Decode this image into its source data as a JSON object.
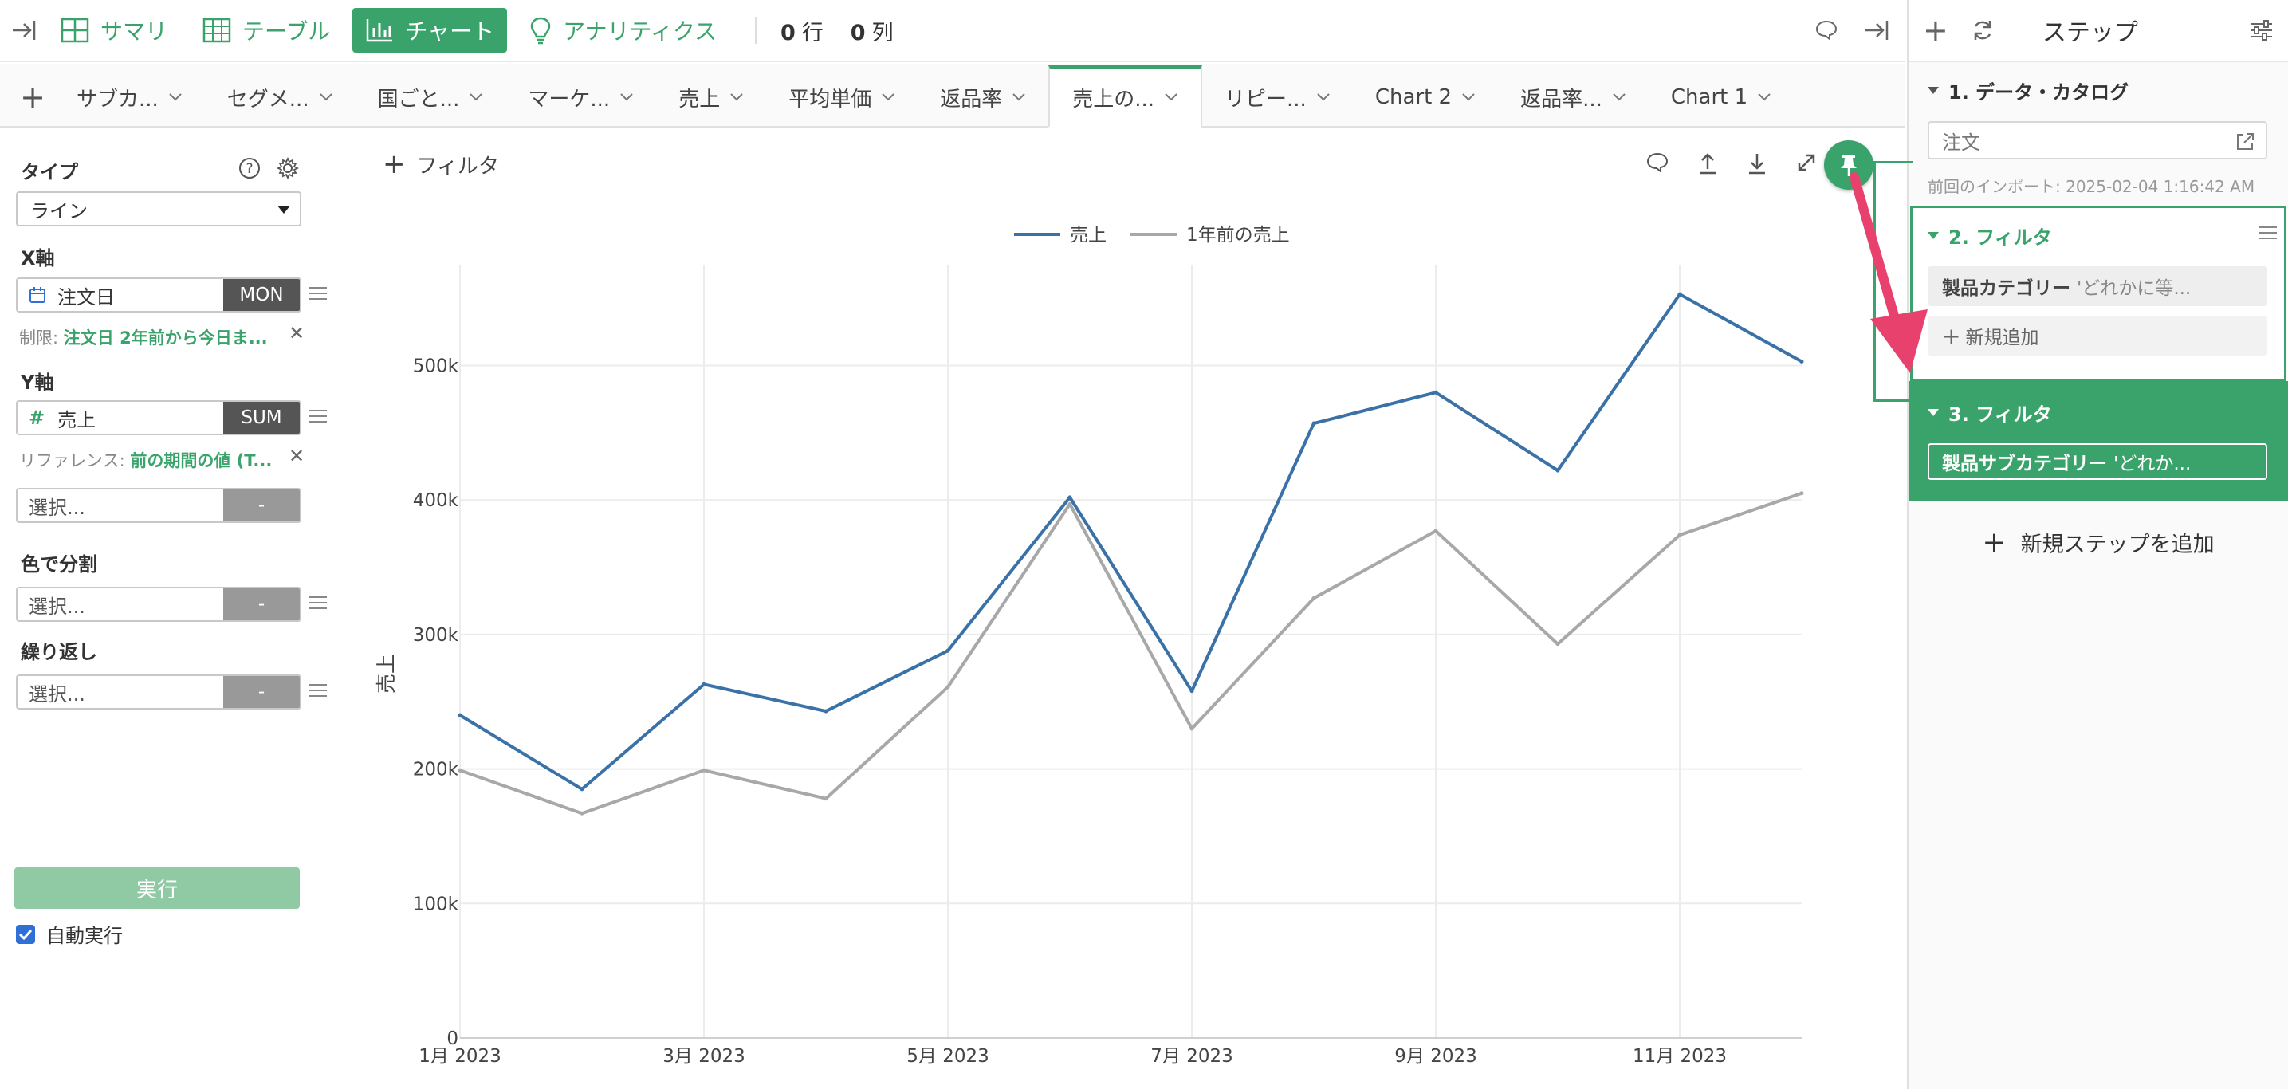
{
  "toolbar": {
    "summary": "サマリ",
    "table": "テーブル",
    "chart": "チャート",
    "analytics": "アナリティクス",
    "rows_num": "0",
    "rows_unit": "行",
    "cols_num": "0",
    "cols_unit": "列"
  },
  "tabs": [
    {
      "label": "サブカ..."
    },
    {
      "label": "セグメ..."
    },
    {
      "label": "国ごと..."
    },
    {
      "label": "マーケ..."
    },
    {
      "label": "売上"
    },
    {
      "label": "平均単価"
    },
    {
      "label": "返品率"
    },
    {
      "label": "売上の...",
      "active": true
    },
    {
      "label": "リピー..."
    },
    {
      "label": "Chart 2"
    },
    {
      "label": "返品率..."
    },
    {
      "label": "Chart 1"
    }
  ],
  "config": {
    "type_label": "タイプ",
    "type_value": "ライン",
    "x_label": "X軸",
    "x_field": "注文日",
    "x_agg": "MON",
    "x_limit_prefix": "制限: ",
    "x_limit_value": "注文日 2年前から今日ま...",
    "y_label": "Y軸",
    "y_field": "売上",
    "y_agg": "SUM",
    "y_ref_prefix": "リファレンス: ",
    "y_ref_value": "前の期間の値 (T...",
    "extra_placeholder": "選択...",
    "extra_agg": "-",
    "color_label": "色で分割",
    "color_placeholder": "選択...",
    "color_agg": "-",
    "repeat_label": "繰り返し",
    "repeat_placeholder": "選択...",
    "repeat_agg": "-",
    "run_label": "実行",
    "auto_run_label": "自動実行"
  },
  "chart_header": {
    "filter_add": "フィルタ"
  },
  "chart_data": {
    "type": "line",
    "title": "",
    "xlabel": "",
    "ylabel": "売上",
    "x": [
      "2023-01",
      "2023-02",
      "2023-03",
      "2023-04",
      "2023-05",
      "2023-06",
      "2023-07",
      "2023-08",
      "2023-09",
      "2023-10",
      "2023-11",
      "2023-12"
    ],
    "x_tick_labels": [
      "1月 2023",
      "3月 2023",
      "5月 2023",
      "7月 2023",
      "9月 2023",
      "11月 2023"
    ],
    "x_tick_indices": [
      0,
      2,
      4,
      6,
      8,
      10
    ],
    "y_ticks": [
      0,
      100000,
      200000,
      300000,
      400000,
      500000
    ],
    "y_tick_labels": [
      "0",
      "100k",
      "200k",
      "300k",
      "400k",
      "500k"
    ],
    "ylim": [
      0,
      575000
    ],
    "grid": true,
    "legend_position": "top",
    "series": [
      {
        "name": "売上",
        "color": "#3a72a8",
        "values": [
          240000,
          185000,
          263000,
          243000,
          288000,
          402000,
          258000,
          457000,
          480000,
          422000,
          553000,
          503000
        ]
      },
      {
        "name": "1年前の売上",
        "color": "#a8a8a8",
        "values": [
          199000,
          167000,
          199000,
          178000,
          261000,
          397000,
          230000,
          327000,
          377000,
          293000,
          374000,
          405000
        ]
      }
    ]
  },
  "steps_panel": {
    "title": "ステップ",
    "step1_title": "1. データ・カタログ",
    "step1_source": "注文",
    "step1_meta": "前回のインポート: 2025-02-04 1:16:42 AM",
    "step2_title": "2. フィルタ",
    "step2_chip_bold": "製品カテゴリー",
    "step2_chip_rest": "'どれかに等...",
    "step2_add": "新規追加",
    "step3_title": "3. フィルタ",
    "step3_chip_bold": "製品サブカテゴリー",
    "step3_chip_rest": "'どれか...",
    "add_step": "新規ステップを追加"
  },
  "colors": {
    "accent": "#3aa36c",
    "sales_line": "#3a72a8",
    "prev_year_line": "#a8a8a8",
    "annotation_arrow": "#e8416e"
  }
}
